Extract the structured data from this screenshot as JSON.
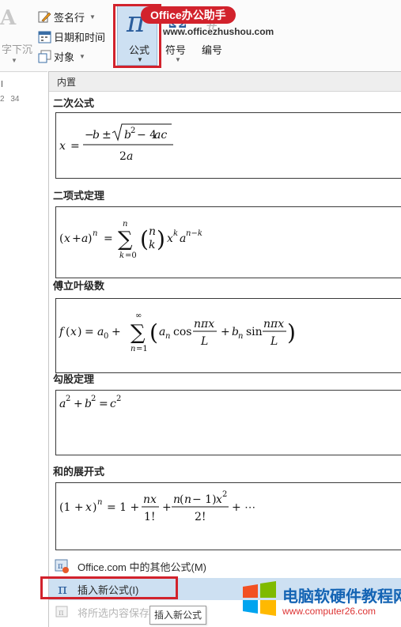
{
  "ribbon": {
    "drop_cap_label": "字下沉",
    "signature_line": "签名行",
    "date_time": "日期和时间",
    "object": "对象",
    "equation": "公式",
    "symbol": "符号",
    "number": "编号"
  },
  "watermark": {
    "badge": "Office办公助手",
    "url": "www.officezhushou.com"
  },
  "ruler": {
    "marks": [
      "2",
      "34"
    ]
  },
  "gallery": {
    "header": "内置",
    "sections": [
      {
        "title": "二次公式"
      },
      {
        "title": "二项式定理"
      },
      {
        "title": "傅立叶级数"
      },
      {
        "title": "勾股定理"
      },
      {
        "title": "和的展开式"
      }
    ],
    "footer": {
      "more_equations": "Office.com 中的其他公式(M)",
      "insert_new": "插入新公式(I)",
      "save_selection": "将所选内容保存"
    }
  },
  "tooltip": "插入新公式",
  "logo": {
    "title": "电脑软硬件教程网",
    "url": "www.computer26.com"
  },
  "colors": {
    "highlight_red": "#d2222c",
    "selection_blue": "#cde0f2",
    "equation_icon_blue": "#2a5d9c"
  }
}
